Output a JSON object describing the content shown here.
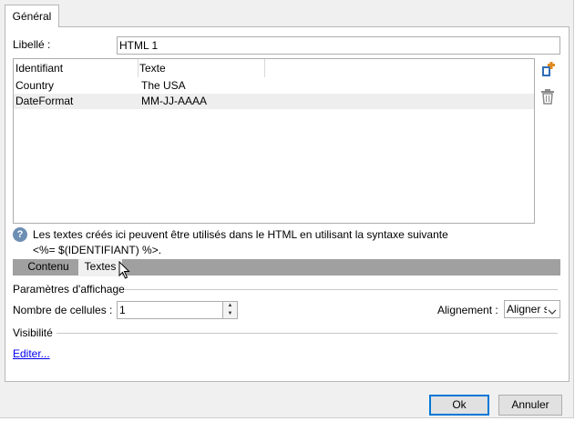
{
  "tabs": {
    "general": "Général"
  },
  "form": {
    "label_caption": "Libellé :",
    "label_value": "HTML 1"
  },
  "list": {
    "columns": [
      "Identifiant",
      "Texte"
    ],
    "rows": [
      {
        "id": "Country",
        "text": "The USA"
      },
      {
        "id": "DateFormat",
        "text": "MM-JJ-AAAA"
      }
    ]
  },
  "side_icons": [
    "add-icon",
    "trash-icon"
  ],
  "info": {
    "line1": "Les textes créés ici peuvent être utilisés dans le HTML en utilisant la syntaxe suivante",
    "line2": "<%= $(IDENTIFIANT) %>."
  },
  "subtabs": [
    "Contenu",
    "Textes"
  ],
  "display_params": {
    "title": "Paramètres d'affichage",
    "cells_label": "Nombre de cellules :",
    "cells_value": "1",
    "align_label": "Alignement :",
    "align_value": "Aligner s"
  },
  "visibility": {
    "title": "Visibilité",
    "edit_link": "Editer..."
  },
  "buttons": {
    "ok": "Ok",
    "cancel": "Annuler"
  },
  "colors": {
    "accent": "#0078d7",
    "subtab_bar": "#a0a0a0",
    "link": "#0000ee"
  }
}
